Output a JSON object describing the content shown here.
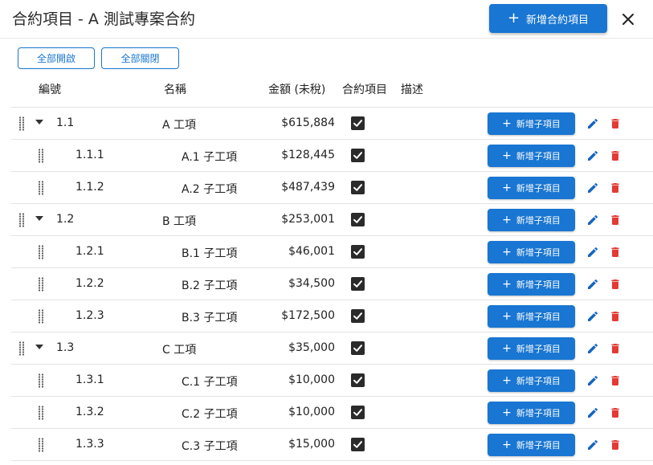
{
  "dialog": {
    "title": "合約項目 - A 測試專案合約",
    "add_contract_item_label": "新增合約項目",
    "close_icon": "close-icon"
  },
  "toolbar": {
    "expand_all_label": "全部開啟",
    "collapse_all_label": "全部關閉"
  },
  "table": {
    "headers": {
      "code": "編號",
      "name": "名稱",
      "amount": "金額 (未稅)",
      "contract_item": "合約項目",
      "description": "描述"
    },
    "add_child_label": "新增子項目",
    "colors": {
      "primary": "#1976d2",
      "delete": "#e53935",
      "edit": "#1565c0",
      "checkbox": "#2b2b2b"
    },
    "rows": [
      {
        "level": 0,
        "code": "1.1",
        "name": "A 工項",
        "amount": "$615,884",
        "checked": true
      },
      {
        "level": 1,
        "code": "1.1.1",
        "name": "A.1 子工項",
        "amount": "$128,445",
        "checked": true
      },
      {
        "level": 1,
        "code": "1.1.2",
        "name": "A.2 子工項",
        "amount": "$487,439",
        "checked": true
      },
      {
        "level": 0,
        "code": "1.2",
        "name": "B 工項",
        "amount": "$253,001",
        "checked": true
      },
      {
        "level": 1,
        "code": "1.2.1",
        "name": "B.1 子工項",
        "amount": "$46,001",
        "checked": true
      },
      {
        "level": 1,
        "code": "1.2.2",
        "name": "B.2 子工項",
        "amount": "$34,500",
        "checked": true
      },
      {
        "level": 1,
        "code": "1.2.3",
        "name": "B.3 子工項",
        "amount": "$172,500",
        "checked": true
      },
      {
        "level": 0,
        "code": "1.3",
        "name": "C 工項",
        "amount": "$35,000",
        "checked": true
      },
      {
        "level": 1,
        "code": "1.3.1",
        "name": "C.1 子工項",
        "amount": "$10,000",
        "checked": true
      },
      {
        "level": 1,
        "code": "1.3.2",
        "name": "C.2 子工項",
        "amount": "$10,000",
        "checked": true
      },
      {
        "level": 1,
        "code": "1.3.3",
        "name": "C.3 子工項",
        "amount": "$15,000",
        "checked": true
      }
    ]
  }
}
